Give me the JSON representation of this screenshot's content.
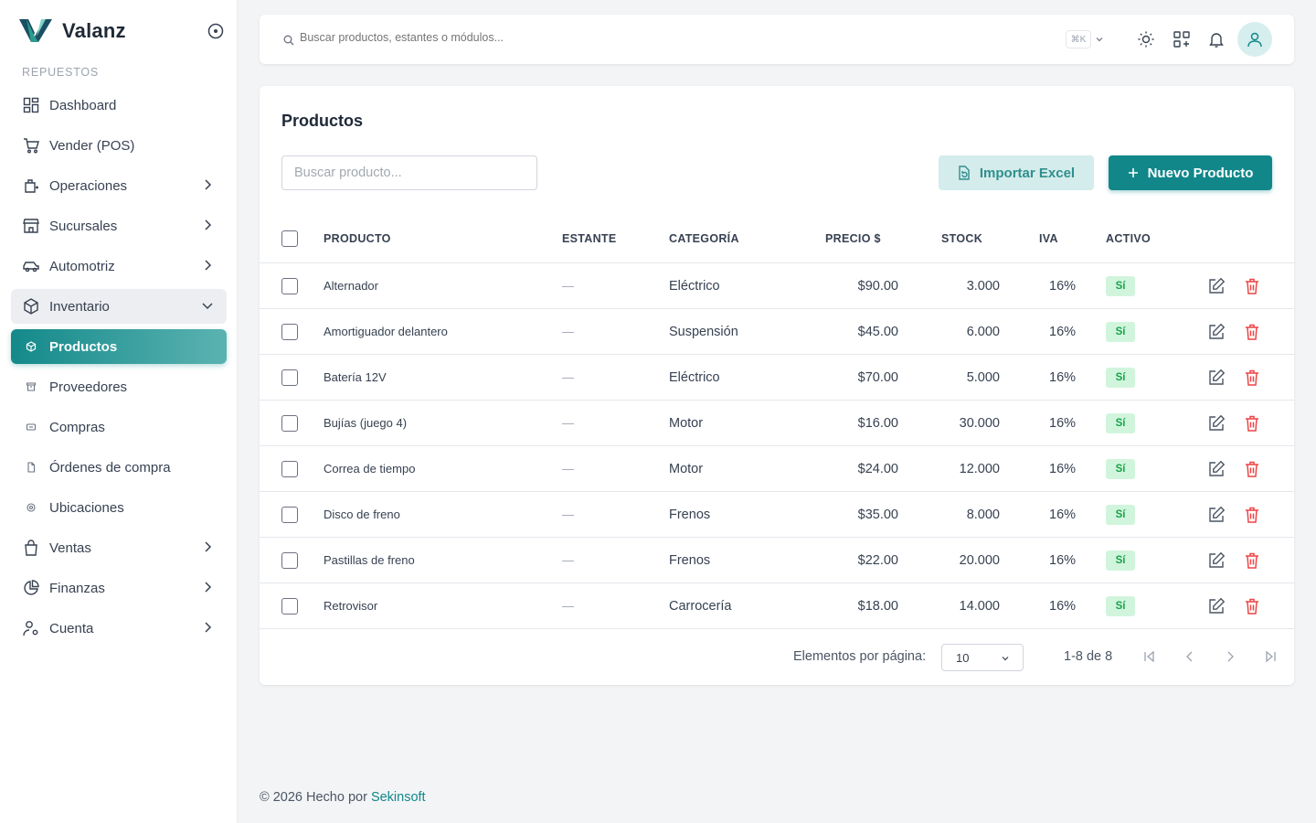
{
  "brand": {
    "name": "Valanz"
  },
  "sidebar": {
    "section": "REPUESTOS",
    "items": [
      {
        "label": "Dashboard",
        "icon": "dashboard-icon"
      },
      {
        "label": "Vender (POS)",
        "icon": "cart-icon"
      },
      {
        "label": "Operaciones",
        "icon": "operations-icon"
      },
      {
        "label": "Sucursales",
        "icon": "store-icon"
      },
      {
        "label": "Automotriz",
        "icon": "car-icon"
      },
      {
        "label": "Inventario",
        "icon": "box-icon"
      },
      {
        "label": "Productos",
        "icon": "box-small-icon"
      },
      {
        "label": "Proveedores",
        "icon": "provider-icon"
      },
      {
        "label": "Compras",
        "icon": "purchases-icon"
      },
      {
        "label": "Órdenes de compra",
        "icon": "document-icon"
      },
      {
        "label": "Ubicaciones",
        "icon": "location-icon"
      },
      {
        "label": "Ventas",
        "icon": "shopping-bag-icon"
      },
      {
        "label": "Finanzas",
        "icon": "pie-chart-icon"
      },
      {
        "label": "Cuenta",
        "icon": "user-gear-icon"
      }
    ]
  },
  "topbar": {
    "search_placeholder": "Buscar productos, estantes o módulos...",
    "shortcut": "⌘K"
  },
  "page": {
    "title": "Productos",
    "search_placeholder": "Buscar producto...",
    "import_label": "Importar Excel",
    "new_label": "Nuevo Producto"
  },
  "table": {
    "headers": {
      "product": "PRODUCTO",
      "shelf": "ESTANTE",
      "category": "CATEGORÍA",
      "price": "PRECIO $",
      "stock": "STOCK",
      "iva": "IVA",
      "active": "ACTIVO"
    },
    "rows": [
      {
        "name": "Alternador",
        "shelf": "—",
        "category": "Eléctrico",
        "price": "$90.00",
        "stock": "3.000",
        "iva": "16%",
        "active": "Sí"
      },
      {
        "name": "Amortiguador delantero",
        "shelf": "—",
        "category": "Suspensión",
        "price": "$45.00",
        "stock": "6.000",
        "iva": "16%",
        "active": "Sí"
      },
      {
        "name": "Batería 12V",
        "shelf": "—",
        "category": "Eléctrico",
        "price": "$70.00",
        "stock": "5.000",
        "iva": "16%",
        "active": "Sí"
      },
      {
        "name": "Bujías (juego 4)",
        "shelf": "—",
        "category": "Motor",
        "price": "$16.00",
        "stock": "30.000",
        "iva": "16%",
        "active": "Sí"
      },
      {
        "name": "Correa de tiempo",
        "shelf": "—",
        "category": "Motor",
        "price": "$24.00",
        "stock": "12.000",
        "iva": "16%",
        "active": "Sí"
      },
      {
        "name": "Disco de freno",
        "shelf": "—",
        "category": "Frenos",
        "price": "$35.00",
        "stock": "8.000",
        "iva": "16%",
        "active": "Sí"
      },
      {
        "name": "Pastillas de freno",
        "shelf": "—",
        "category": "Frenos",
        "price": "$22.00",
        "stock": "20.000",
        "iva": "16%",
        "active": "Sí"
      },
      {
        "name": "Retrovisor",
        "shelf": "—",
        "category": "Carrocería",
        "price": "$18.00",
        "stock": "14.000",
        "iva": "16%",
        "active": "Sí"
      }
    ]
  },
  "pagination": {
    "label": "Elementos por página:",
    "per_page": "10",
    "range": "1-8 de 8"
  },
  "footer": {
    "text": "© 2026 Hecho por ",
    "link": "Sekinsoft"
  },
  "colors": {
    "primary": "#11878a",
    "badge_bg": "#d1f5dc",
    "badge_text": "#16a34a",
    "delete": "#ef4444"
  }
}
